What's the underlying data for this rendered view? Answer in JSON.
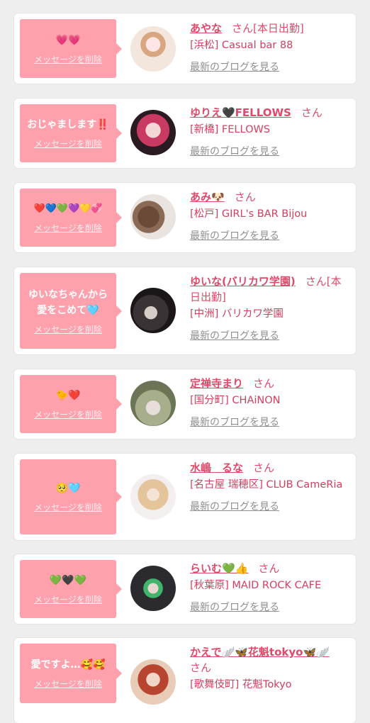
{
  "cards": [
    {
      "message": "💗💗",
      "delete_label": "メッセージを削除",
      "name": "あやな",
      "san": "さん",
      "suffix": "[本日出勤]",
      "shop": "[浜松] Casual bar 88",
      "blog": "最新のブログを見る",
      "avatar_colors": [
        "#f2e6dd",
        "#c9a483"
      ]
    },
    {
      "message": "おじゃまします‼️",
      "delete_label": "メッセージを削除",
      "name": "ゆりえ🖤FELLOWS",
      "san": "さん",
      "suffix": "",
      "shop": "[新橋] FELLOWS",
      "blog": "最新のブログを見る",
      "avatar_colors": [
        "#2a1a22",
        "#c93a62"
      ]
    },
    {
      "message": "❤️💙💚💜💛💞",
      "delete_label": "メッセージを削除",
      "name": "あみ🐶",
      "san": "さん",
      "suffix": "",
      "shop": "[松戸] GIRL's BAR Bijou",
      "blog": "最新のブログを見る",
      "avatar_colors": [
        "#e9e4e0",
        "#5c3e2f"
      ]
    },
    {
      "message": "ゆいなちゃんから愛をこめて🩵",
      "delete_label": "メッセージを削除",
      "name": "ゆいな(バリカワ学園)",
      "san": "さん",
      "suffix": "[本日出勤]",
      "shop": "[中洲] バリカワ学園",
      "blog": "最新のブログを見る",
      "avatar_colors": [
        "#3a3336",
        "#1b1618"
      ]
    },
    {
      "message": "🐤❤️",
      "delete_label": "メッセージを削除",
      "name": "定禅寺まり",
      "san": "さん",
      "suffix": "",
      "shop": "[国分町] CHAiNON",
      "blog": "最新のブログを見る",
      "avatar_colors": [
        "#a6ae8c",
        "#6b7556"
      ]
    },
    {
      "message": "🥺🩵",
      "delete_label": "メッセージを削除",
      "name": "水嶋　るな",
      "san": "さん",
      "suffix": "",
      "shop": "[名古屋 瑞穂区] CLUB CameRia",
      "blog": "最新のブログを見る",
      "avatar_colors": [
        "#f3efee",
        "#e4c49a"
      ]
    },
    {
      "message": "💚🖤💚",
      "delete_label": "メッセージを削除",
      "name": "らいむ💚👍",
      "san": "さん",
      "suffix": "",
      "shop": "[秋葉原] MAID ROCK CAFE",
      "blog": "最新のブログを見る",
      "avatar_colors": [
        "#2a2a2f",
        "#3fb46a"
      ]
    },
    {
      "message": "愛ですよ…🥰🥰",
      "delete_label": "メッセージを削除",
      "name": "かえで🪽🦋花魁tokyo🦋🪽",
      "san": "さん",
      "suffix": "",
      "shop": "[歌舞伎町] 花魁Tokyo",
      "blog": "",
      "avatar_colors": [
        "#e8ccb8",
        "#b7452f"
      ]
    }
  ]
}
